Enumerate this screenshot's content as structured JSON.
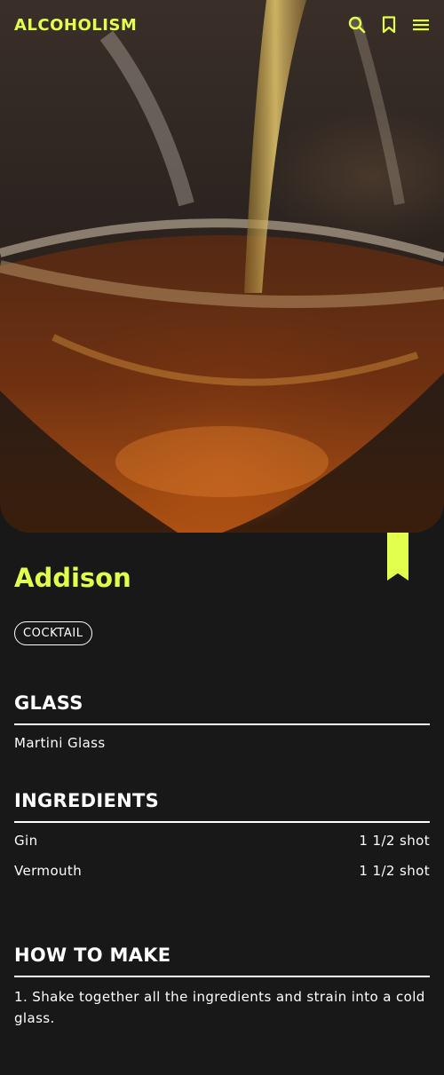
{
  "header": {
    "logo": "ALCOHOLISM",
    "icons": [
      "search-icon",
      "bookmark-icon",
      "menu-icon"
    ]
  },
  "colors": {
    "accent": "#e3ff4e",
    "background": "#181818",
    "text": "#ffffff"
  },
  "drink": {
    "name": "Addison",
    "category": "COCKTAIL"
  },
  "glass": {
    "heading": "GLASS",
    "value": "Martini Glass"
  },
  "ingredients": {
    "heading": "INGREDIENTS",
    "items": [
      {
        "name": "Gin",
        "amount": "1 1/2 shot"
      },
      {
        "name": "Vermouth",
        "amount": "1 1/2 shot"
      }
    ]
  },
  "how_to": {
    "heading": "HOW TO MAKE",
    "steps": "1. Shake together all the ingredients and strain into a cold glass."
  }
}
